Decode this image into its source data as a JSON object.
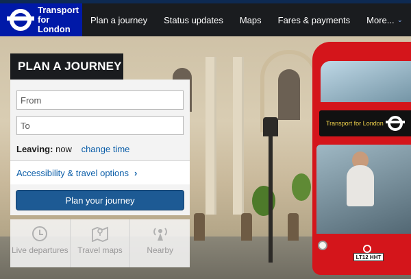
{
  "brand": {
    "line1": "Transport",
    "line2": "for London"
  },
  "nav": {
    "items": [
      "Plan a journey",
      "Status updates",
      "Maps",
      "Fares & payments",
      "More..."
    ]
  },
  "planner": {
    "title": "PLAN A JOURNEY",
    "from_placeholder": "From",
    "to_placeholder": "To",
    "leaving_label": "Leaving:",
    "leaving_value": "now",
    "change_time": "change time",
    "accessibility": "Accessibility & travel options",
    "submit": "Plan your journey"
  },
  "quick_links": [
    {
      "label": "Live departures",
      "icon": "clock-icon"
    },
    {
      "label": "Travel maps",
      "icon": "map-icon"
    },
    {
      "label": "Nearby",
      "icon": "nearby-icon"
    }
  ],
  "hero": {
    "bus_destination": "Transport for London",
    "bus_plate": "LT12 HHT"
  },
  "colors": {
    "brand_blue": "#0019a8",
    "nav_bg": "#1a1c1f",
    "link_blue": "#0a5da8",
    "button_blue": "#1d5a94",
    "bus_red": "#d4151b"
  }
}
